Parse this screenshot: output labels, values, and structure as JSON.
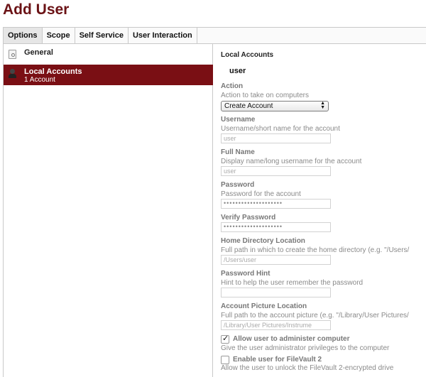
{
  "page_title": "Add User",
  "tabs": [
    {
      "label": "Options"
    },
    {
      "label": "Scope"
    },
    {
      "label": "Self Service"
    },
    {
      "label": "User Interaction"
    }
  ],
  "sidebar": {
    "general": {
      "label": "General",
      "icon": "settings-doc-icon"
    },
    "local_accounts": {
      "label": "Local Accounts",
      "sublabel": "1 Account",
      "icon": "user-icon"
    }
  },
  "panel": {
    "section_title": "Local Accounts",
    "subject": "user",
    "action": {
      "label": "Action",
      "desc": "Action to take on computers",
      "value": "Create Account"
    },
    "username": {
      "label": "Username",
      "desc": "Username/short name for the account",
      "value": "user"
    },
    "full_name": {
      "label": "Full Name",
      "desc": "Display name/long username for the account",
      "value": "user"
    },
    "password": {
      "label": "Password",
      "desc": "Password for the account",
      "value": "••••••••••••••••••••"
    },
    "verify_password": {
      "label": "Verify Password",
      "value": "••••••••••••••••••••"
    },
    "home_dir": {
      "label": "Home Directory Location",
      "desc": "Full path in which to create the home directory (e.g. \"/Users/",
      "value": "/Users/user"
    },
    "password_hint": {
      "label": "Password Hint",
      "desc": "Hint to help the user remember the password",
      "value": ""
    },
    "picture": {
      "label": "Account Picture Location",
      "desc": "Full path to the account picture (e.g. \"/Library/User Pictures/",
      "value": "/Library/User Pictures/Instrume"
    },
    "allow_admin": {
      "label": "Allow user to administer computer",
      "desc": "Give the user administrator privileges to the computer",
      "checked": true,
      "mark": "✓"
    },
    "filevault": {
      "label": "Enable user for FileVault 2",
      "desc": "Allow the user to unlock the FileVault 2-encrypted drive",
      "checked": false
    }
  }
}
